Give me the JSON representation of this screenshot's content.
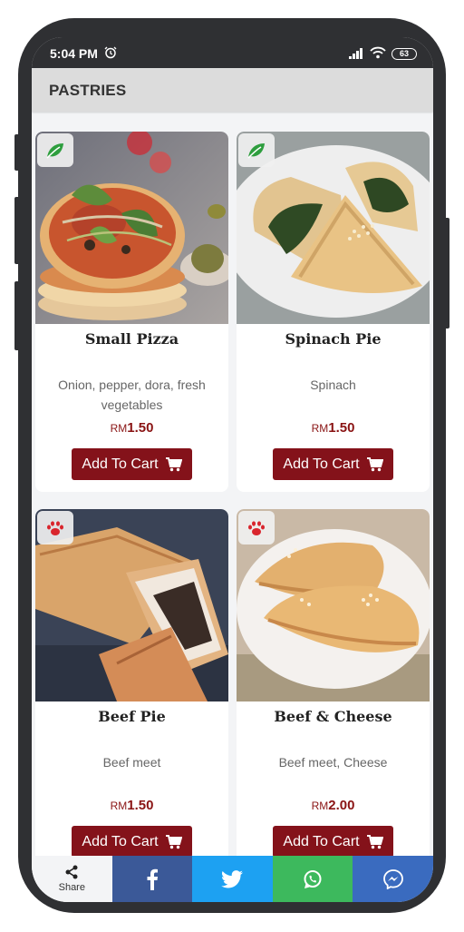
{
  "status_bar": {
    "time": "5:04 PM",
    "battery": "63"
  },
  "app_bar": {
    "title": "PASTRIES"
  },
  "products": [
    {
      "title": "Small Pizza",
      "description": "Onion, pepper, dora, fresh vegetables",
      "currency": "RM",
      "price": "1.50",
      "button_label": "Add To Cart",
      "badge_icon": "leaf-icon"
    },
    {
      "title": "Spinach Pie",
      "description": "Spinach",
      "currency": "RM",
      "price": "1.50",
      "button_label": "Add To Cart",
      "badge_icon": "leaf-icon"
    },
    {
      "title": "Beef Pie",
      "description": "Beef meet",
      "currency": "RM",
      "price": "1.50",
      "button_label": "Add To Cart",
      "badge_icon": "paw-icon"
    },
    {
      "title": "Beef & Cheese",
      "description": "Beef meet, Cheese",
      "currency": "RM",
      "price": "2.00",
      "button_label": "Add To Cart",
      "badge_icon": "paw-icon"
    }
  ],
  "share_bar": {
    "share_label": "Share",
    "colors": {
      "facebook": "#3b5998",
      "twitter": "#1da1f2",
      "whatsapp": "#3db95d",
      "messenger": "#3a6bbf"
    }
  },
  "colors": {
    "accent": "#84121a",
    "leaf": "#2e9e3e",
    "paw": "#d9252d"
  }
}
